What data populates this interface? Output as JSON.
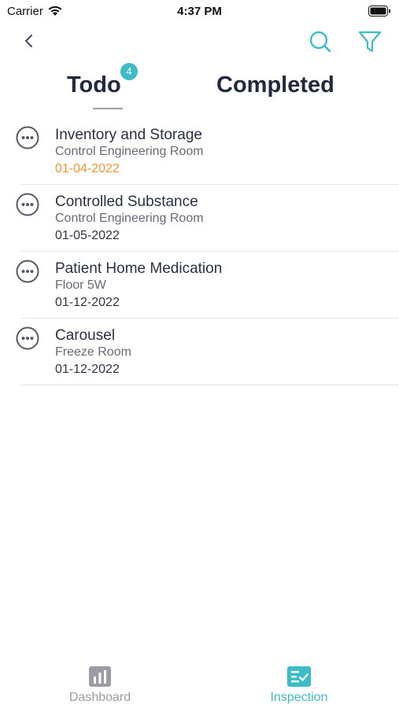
{
  "status_bar": {
    "carrier": "Carrier",
    "time": "4:37 PM"
  },
  "tabs": {
    "todo_label": "Todo",
    "todo_badge": "4",
    "completed_label": "Completed"
  },
  "items": [
    {
      "title": "Inventory and Storage",
      "location": "Control Engineering Room",
      "date": "01-04-2022",
      "overdue": true
    },
    {
      "title": "Controlled Substance",
      "location": "Control Engineering Room",
      "date": "01-05-2022",
      "overdue": false
    },
    {
      "title": "Patient Home Medication",
      "location": "Floor 5W",
      "date": "01-12-2022",
      "overdue": false
    },
    {
      "title": "Carousel",
      "location": "Freeze Room",
      "date": "01-12-2022",
      "overdue": false
    }
  ],
  "tab_bar": {
    "dashboard_label": "Dashboard",
    "inspection_label": "Inspection",
    "active": "Inspection"
  },
  "colors": {
    "accent": "#3dbcc8",
    "overdue": "#f0962e",
    "title": "#22283d",
    "inactive": "#9a9da4"
  },
  "icons": {
    "back": "chevron-left-icon",
    "search": "search-icon",
    "filter": "filter-icon",
    "item_menu": "more-horizontal-circle-icon",
    "dashboard": "bar-chart-icon",
    "inspection": "checklist-icon"
  }
}
